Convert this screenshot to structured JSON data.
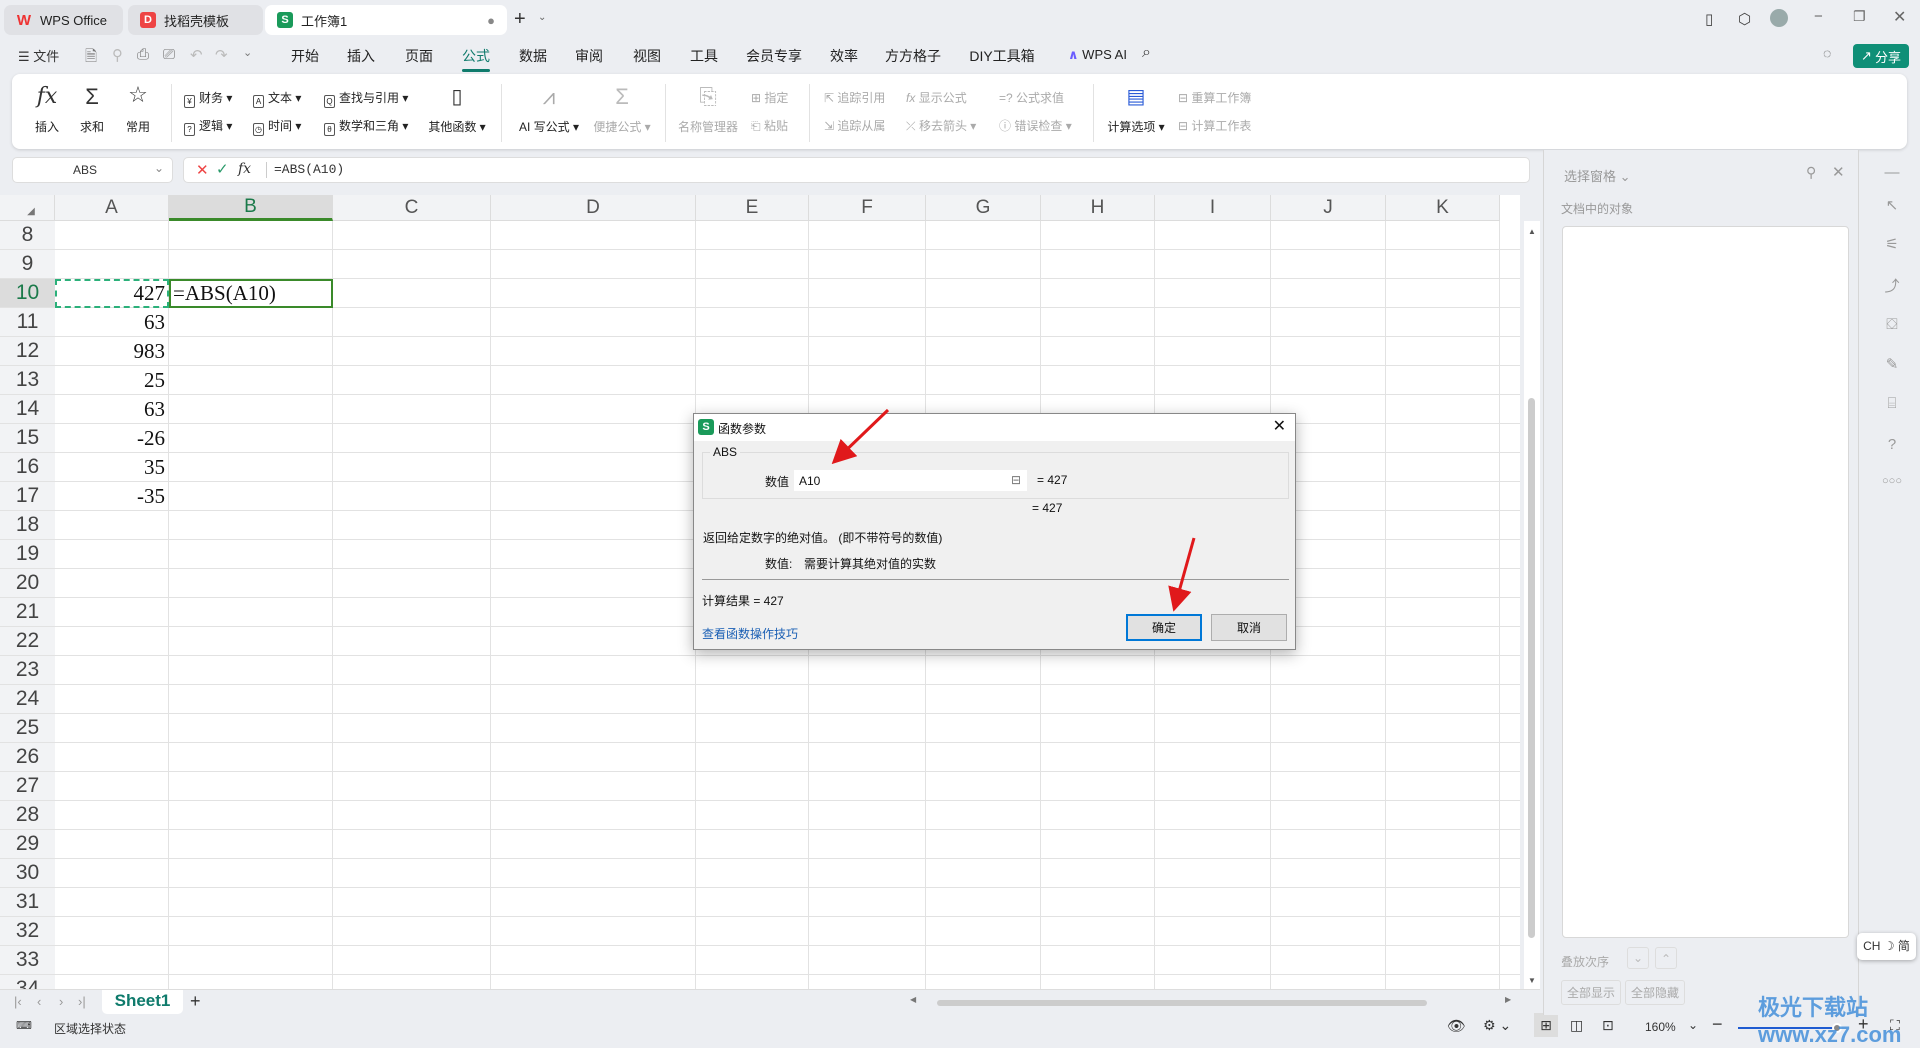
{
  "titlebar": {
    "tabs": [
      {
        "label": "WPS Office",
        "icon": "wps-logo"
      },
      {
        "label": "找稻壳模板",
        "icon": "docer-logo"
      },
      {
        "label": "工作簿1",
        "icon": "spreadsheet-logo"
      }
    ],
    "new_tab": "+",
    "avatar": "user-avatar"
  },
  "menu": {
    "file": "文件",
    "items": [
      "开始",
      "插入",
      "页面",
      "公式",
      "数据",
      "审阅",
      "视图",
      "工具",
      "会员专享",
      "效率",
      "方方格子",
      "DIY工具箱"
    ],
    "active": "公式",
    "wps_ai": "WPS AI",
    "share": "分享"
  },
  "ribbon": {
    "insert": "插入",
    "sum": "求和",
    "common": "常用",
    "finance": "财务",
    "logic": "逻辑",
    "text": "文本",
    "time": "时间",
    "lookup": "查找与引用",
    "math": "数学和三角",
    "other": "其他函数",
    "ai_formula": "AI 写公式",
    "quick_formula": "便捷公式",
    "name_manager": "名称管理器",
    "define": "指定",
    "paste": "粘贴",
    "trace_prec": "追踪引用",
    "trace_dep": "追踪从属",
    "show_formula": "显示公式",
    "remove_arrows": "移去箭头",
    "eval_formula": "公式求值",
    "error_check": "错误检查",
    "calc_options": "计算选项",
    "recalc_book": "重算工作簿",
    "calc_sheet": "计算工作表"
  },
  "formula_bar": {
    "name_box": "ABS",
    "formula": "=ABS(A10)"
  },
  "sheet": {
    "columns": [
      "A",
      "B",
      "C",
      "D",
      "E",
      "F",
      "G",
      "H",
      "I",
      "J",
      "K"
    ],
    "selected_column": "B",
    "rows": [
      8,
      9,
      10,
      11,
      12,
      13,
      14,
      15,
      16,
      17,
      18,
      19,
      20,
      21,
      22,
      23,
      24,
      25,
      26,
      27,
      28,
      29,
      30,
      31,
      32,
      33,
      34
    ],
    "selected_row": 10,
    "cells": [
      {
        "ref": "A10",
        "value": "427"
      },
      {
        "ref": "A11",
        "value": "63"
      },
      {
        "ref": "A12",
        "value": "983"
      },
      {
        "ref": "A13",
        "value": "25"
      },
      {
        "ref": "A14",
        "value": "63"
      },
      {
        "ref": "A15",
        "value": "-26"
      },
      {
        "ref": "A16",
        "value": "35"
      },
      {
        "ref": "A17",
        "value": "-35"
      }
    ],
    "editing_cell": {
      "ref": "B10",
      "value": "=ABS(A10)"
    }
  },
  "dialog": {
    "title": "函数参数",
    "function": "ABS",
    "arg_label": "数值",
    "arg_value": "A10",
    "arg_result": "= 427",
    "result_preview": "= 427",
    "description": "返回给定数字的绝对值。 (即不带符号的数值)",
    "arg_desc_label": "数值:",
    "arg_desc": "需要计算其绝对值的实数",
    "calc_result": "计算结果  =  427",
    "help_link": "查看函数操作技巧",
    "ok": "确定",
    "cancel": "取消"
  },
  "selection_pane": {
    "title": "选择窗格",
    "objects_label": "文档中的对象",
    "order_label": "叠放次序",
    "show_all": "全部显示",
    "hide_all": "全部隐藏"
  },
  "ime": "CH ☽ 简",
  "sheet_tabs": {
    "tabs": [
      "Sheet1"
    ],
    "add": "+"
  },
  "status": {
    "text": "区域选择状态",
    "zoom": "160%",
    "zoom_level_percent": 160
  },
  "watermark": "极光下载站 www.xz7.com",
  "colors": {
    "accent": "#0f7b6c",
    "selection": "#3a8a2a",
    "arrow": "#e0191b",
    "link": "#1a5fb4"
  }
}
